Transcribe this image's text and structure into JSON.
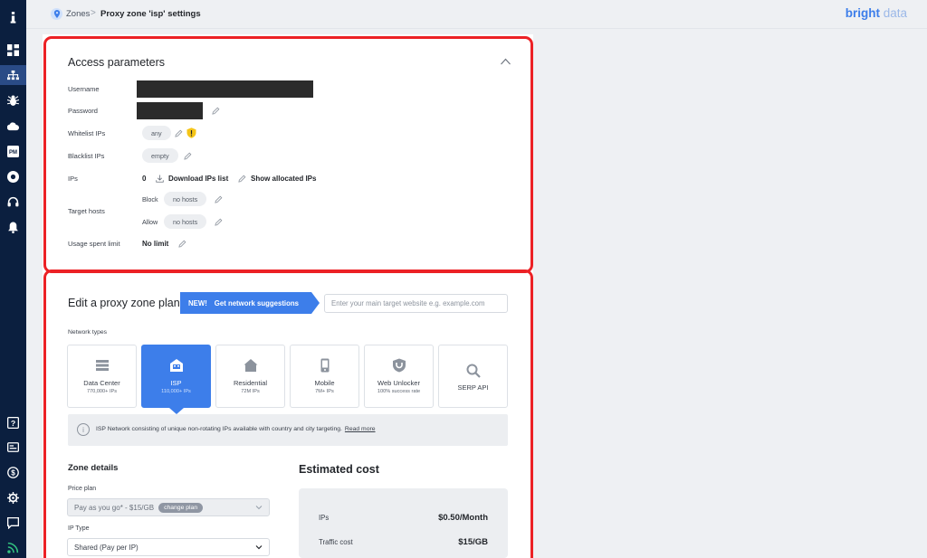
{
  "breadcrumb": {
    "zones": "Zones",
    "separator": ">",
    "current": "Proxy zone 'isp' settings"
  },
  "logo": {
    "bright": "bright",
    "data": " data"
  },
  "access": {
    "title": "Access parameters",
    "username_label": "Username",
    "password_label": "Password",
    "whitelist_label": "Whitelist IPs",
    "whitelist_value": "any",
    "blacklist_label": "Blacklist IPs",
    "blacklist_value": "empty",
    "ips_label": "IPs",
    "ips_count": "0",
    "download_label": "Download IPs list",
    "show_allocated_label": "Show allocated IPs",
    "target_hosts_label": "Target hosts",
    "block_label": "Block",
    "block_value": "no hosts",
    "allow_label": "Allow",
    "allow_value": "no hosts",
    "usage_label": "Usage spent limit",
    "usage_value": "No limit"
  },
  "plan": {
    "title": "Edit a proxy zone plan",
    "new_tag": "NEW!",
    "suggestions_label": "Get network suggestions",
    "search_placeholder": "Enter your main target website e.g. example.com",
    "network_types_label": "Network types",
    "networks": [
      {
        "title": "Data Center",
        "sub": "770,000+ IPs",
        "icon": "server-icon"
      },
      {
        "title": "ISP",
        "sub": "110,000+ IPs",
        "icon": "isp-building-icon",
        "selected": true
      },
      {
        "title": "Residential",
        "sub": "72M IPs",
        "icon": "house-icon"
      },
      {
        "title": "Mobile",
        "sub": "7M+ IPs",
        "icon": "mobile-icon"
      },
      {
        "title": "Web Unlocker",
        "sub": "100% success rate",
        "icon": "unlock-shield-icon"
      },
      {
        "title": "SERP API",
        "sub": "",
        "icon": "search-icon"
      }
    ],
    "info_text": "ISP Network consisting of unique non-rotating IPs available with country and city targeting.",
    "info_link": "Read more"
  },
  "zone_details": {
    "title": "Zone details",
    "price_plan_label": "Price plan",
    "price_plan_value": "Pay as you go* - $15/GB",
    "change_plan_label": "change plan",
    "ip_type_label": "IP Type",
    "ip_type_value": "Shared (Pay per IP)"
  },
  "estimated_cost": {
    "title": "Estimated cost",
    "rows": [
      {
        "label": "IPs",
        "value": "$0.50/Month"
      },
      {
        "label": "Traffic cost",
        "value": "$15/GB"
      }
    ]
  },
  "colors": {
    "accent": "#3d7eea",
    "sidebar": "#0b1f3f",
    "highlight": "#ec2125"
  }
}
